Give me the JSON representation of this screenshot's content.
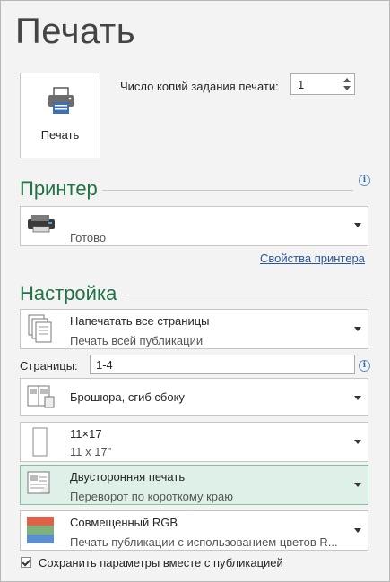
{
  "title": "Печать",
  "print_button": {
    "label": "Печать"
  },
  "copies": {
    "label": "Число копий задания печати:",
    "value": "1"
  },
  "printer_section": {
    "heading": "Принтер",
    "info_icon": "info-icon",
    "selected_printer": {
      "name": "",
      "status": "Готово"
    },
    "properties_link": "Свойства принтера"
  },
  "settings_section": {
    "heading": "Настройка",
    "pages_dropdown": {
      "line1": "Напечатать все страницы",
      "line2": "Печать всей публикации"
    },
    "pages_field": {
      "label": "Страницы:",
      "value": "1-4"
    },
    "layout_dropdown": {
      "line1": "Брошюра, сгиб сбоку"
    },
    "paper_dropdown": {
      "line1": "11×17",
      "line2": "11 x 17\""
    },
    "duplex_dropdown": {
      "line1": "Двусторонняя печать",
      "line2": "Переворот по короткому краю"
    },
    "color_dropdown": {
      "line1": "Совмещенный RGB",
      "line2": "Печать публикации с использованием цветов R..."
    },
    "save_settings": {
      "label": "Сохранить параметры вместе с публикацией",
      "checked": true
    }
  },
  "colors": {
    "accent": "#217346",
    "link": "#2b579a",
    "selected_bg": "#dff0e8"
  }
}
